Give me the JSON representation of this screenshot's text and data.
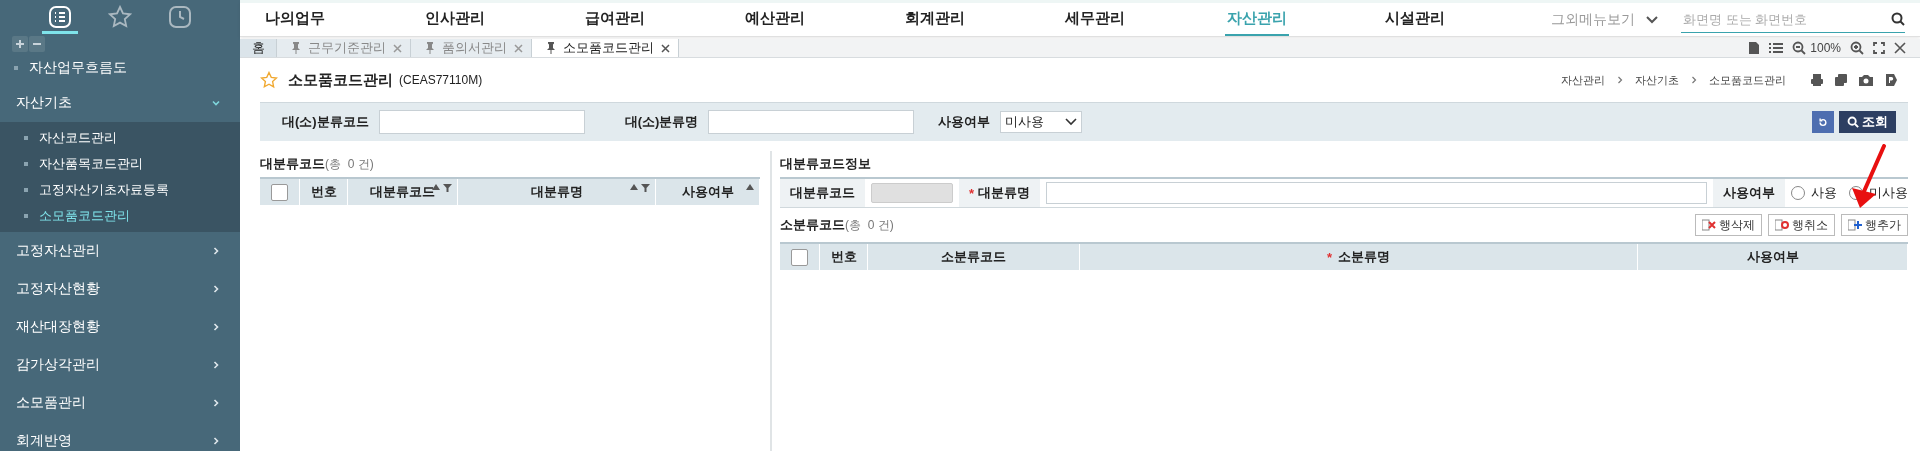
{
  "sidebar": {
    "top_icons": [
      {
        "kind": "list",
        "selected": true
      },
      {
        "kind": "star",
        "selected": false
      },
      {
        "kind": "clock",
        "selected": false
      }
    ],
    "items": [
      {
        "label": "자산업무흐름도",
        "kind": "leaf",
        "selected": false
      },
      {
        "label": "자산기초",
        "kind": "group",
        "expanded": true,
        "children": [
          {
            "label": "자산코드관리",
            "selected": false
          },
          {
            "label": "자산품목코드관리",
            "selected": false
          },
          {
            "label": "고정자산기초자료등록",
            "selected": false
          },
          {
            "label": "소모품코드관리",
            "selected": true
          }
        ]
      },
      {
        "label": "고정자산관리",
        "kind": "group",
        "expanded": false
      },
      {
        "label": "고정자산현황",
        "kind": "group",
        "expanded": false
      },
      {
        "label": "재산대장현황",
        "kind": "group",
        "expanded": false
      },
      {
        "label": "감가상각관리",
        "kind": "group",
        "expanded": false
      },
      {
        "label": "소모품관리",
        "kind": "group",
        "expanded": false
      },
      {
        "label": "회계반영",
        "kind": "group",
        "expanded": false
      }
    ]
  },
  "nav": {
    "menus": [
      {
        "label": "나의업무",
        "selected": false
      },
      {
        "label": "인사관리",
        "selected": false
      },
      {
        "label": "급여관리",
        "selected": false
      },
      {
        "label": "예산관리",
        "selected": false
      },
      {
        "label": "회계관리",
        "selected": false
      },
      {
        "label": "세무관리",
        "selected": false
      },
      {
        "label": "자산관리",
        "selected": true
      },
      {
        "label": "시설관리",
        "selected": false
      }
    ],
    "more_menu": "그외메뉴보기",
    "search": {
      "placeholder": "화면명 또는 화면번호"
    }
  },
  "tabs": [
    {
      "label": "홈",
      "kind": "home",
      "selected": false
    },
    {
      "label": "근무기준관리",
      "kind": "page",
      "selected": false
    },
    {
      "label": "품의서관리",
      "kind": "page",
      "selected": false
    },
    {
      "label": "소모품코드관리",
      "kind": "page",
      "selected": true
    }
  ],
  "zoom": "100%",
  "page": {
    "title": "소모품코드관리",
    "code": "(CEAS77110M)",
    "breadcrumb": [
      "자산관리",
      "자산기초",
      "소모품코드관리"
    ]
  },
  "filters": [
    {
      "label": "대(소)분류코드",
      "kind": "text"
    },
    {
      "label": "대(소)분류명",
      "kind": "text"
    },
    {
      "label": "사용여부",
      "kind": "select",
      "value": "미사용"
    }
  ],
  "search_button": "조회",
  "left_grid": {
    "title": "대분류코드",
    "count": "(총  0 건)",
    "select_all": {
      "checked": false
    },
    "columns": [
      {
        "label": "번호",
        "sortable": false,
        "filterable": false
      },
      {
        "label": "대분류코드",
        "sortable": true,
        "filterable": true
      },
      {
        "label": "대분류명",
        "sortable": true,
        "filterable": true
      },
      {
        "label": "사용여부",
        "sortable": true,
        "filterable": false
      }
    ]
  },
  "info": {
    "title": "대분류코드정보",
    "code_label": "대분류코드",
    "name_mark": "*",
    "name_label": "대분류명",
    "use_label": "사용여부",
    "use_options": [
      {
        "label": "사용",
        "selected": false
      },
      {
        "label": "미사용",
        "selected": false
      }
    ]
  },
  "sub_grid": {
    "title": "소분류코드",
    "count": "(총  0 건)",
    "buttons": [
      {
        "label": "행삭제",
        "kind": "delete"
      },
      {
        "label": "행취소",
        "kind": "cancel"
      },
      {
        "label": "행추가",
        "kind": "add"
      }
    ],
    "select_all": {
      "checked": false
    },
    "columns": [
      {
        "label": "번호"
      },
      {
        "label": "소분류코드"
      },
      {
        "label": "소분류명",
        "mark": "*"
      },
      {
        "label": "사용여부"
      }
    ]
  }
}
